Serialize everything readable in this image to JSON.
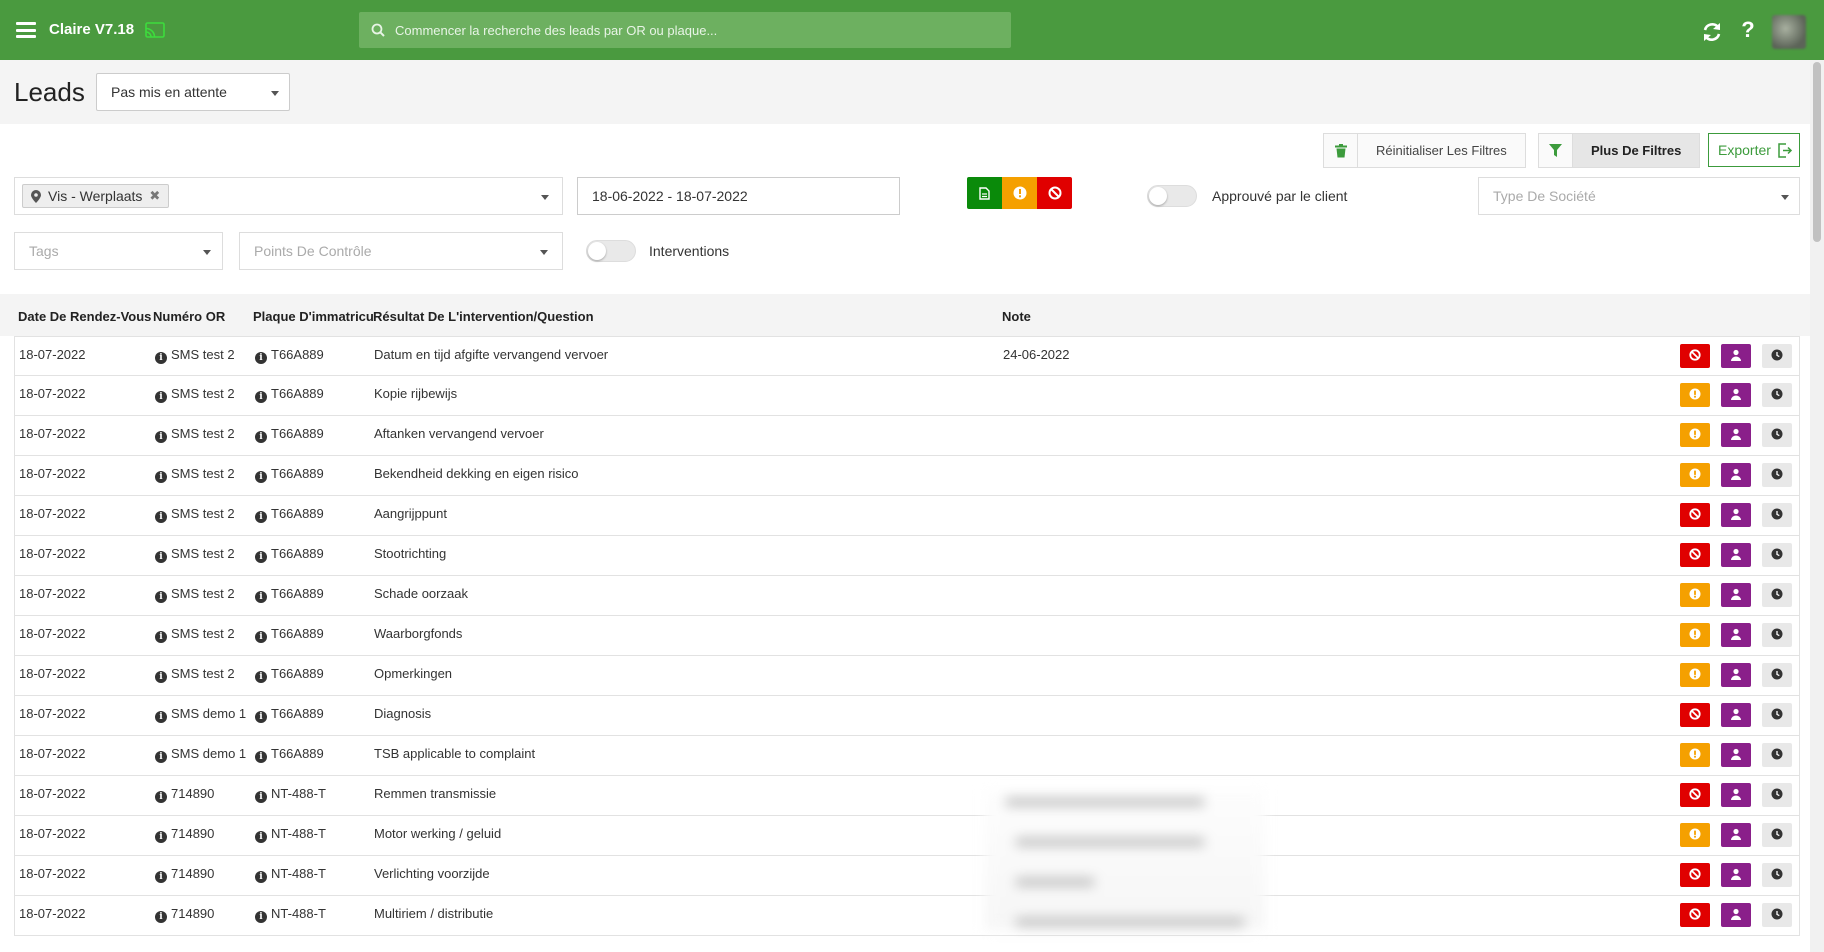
{
  "app": {
    "title": "Claire V7.18"
  },
  "search": {
    "placeholder": "Commencer la recherche des leads par OR ou plaque..."
  },
  "page": {
    "title": "Leads",
    "status_filter": "Pas mis en attente"
  },
  "toolbar": {
    "reset_label": "Réinitialiser Les Filtres",
    "more_filters_label": "Plus De Filtres",
    "export_label": "Exporter"
  },
  "filters": {
    "location_tag": "Vis - Werplaats",
    "date_range": "18-06-2022 - 18-07-2022",
    "approved_label": "Approuvé par le client",
    "company_type_placeholder": "Type De Société",
    "tags_placeholder": "Tags",
    "checkpoints_placeholder": "Points De Contrôle",
    "interventions_label": "Interventions"
  },
  "table": {
    "headers": [
      "Date De Rendez-Vous",
      "Numéro OR",
      "Plaque D'immatricu",
      "Résultat De L'intervention/Question",
      "Note"
    ],
    "rows": [
      {
        "date": "18-07-2022",
        "or": "SMS test 2",
        "plate": "T66A889",
        "result": "Datum en tijd afgifte vervangend vervoer",
        "note": "24-06-2022",
        "status": "red"
      },
      {
        "date": "18-07-2022",
        "or": "SMS test 2",
        "plate": "T66A889",
        "result": "Kopie rijbewijs",
        "note": "",
        "status": "orange"
      },
      {
        "date": "18-07-2022",
        "or": "SMS test 2",
        "plate": "T66A889",
        "result": "Aftanken vervangend vervoer",
        "note": "",
        "status": "orange"
      },
      {
        "date": "18-07-2022",
        "or": "SMS test 2",
        "plate": "T66A889",
        "result": "Bekendheid dekking en eigen risico",
        "note": "",
        "status": "orange"
      },
      {
        "date": "18-07-2022",
        "or": "SMS test 2",
        "plate": "T66A889",
        "result": "Aangrijppunt",
        "note": "",
        "status": "red"
      },
      {
        "date": "18-07-2022",
        "or": "SMS test 2",
        "plate": "T66A889",
        "result": "Stootrichting",
        "note": "",
        "status": "red"
      },
      {
        "date": "18-07-2022",
        "or": "SMS test 2",
        "plate": "T66A889",
        "result": "Schade oorzaak",
        "note": "",
        "status": "orange"
      },
      {
        "date": "18-07-2022",
        "or": "SMS test 2",
        "plate": "T66A889",
        "result": "Waarborgfonds",
        "note": "",
        "status": "orange"
      },
      {
        "date": "18-07-2022",
        "or": "SMS test 2",
        "plate": "T66A889",
        "result": "Opmerkingen",
        "note": "",
        "status": "orange"
      },
      {
        "date": "18-07-2022",
        "or": "SMS demo 1",
        "plate": "T66A889",
        "result": "Diagnosis",
        "note": "",
        "status": "red"
      },
      {
        "date": "18-07-2022",
        "or": "SMS demo 1",
        "plate": "T66A889",
        "result": "TSB applicable to complaint",
        "note": "",
        "status": "orange"
      },
      {
        "date": "18-07-2022",
        "or": "714890",
        "plate": "NT-488-T",
        "result": "Remmen transmissie",
        "note": "",
        "status": "red"
      },
      {
        "date": "18-07-2022",
        "or": "714890",
        "plate": "NT-488-T",
        "result": "Motor werking / geluid",
        "note": "",
        "status": "orange"
      },
      {
        "date": "18-07-2022",
        "or": "714890",
        "plate": "NT-488-T",
        "result": "Verlichting voorzijde",
        "note": "",
        "status": "red"
      },
      {
        "date": "18-07-2022",
        "or": "714890",
        "plate": "NT-488-T",
        "result": "Multiriem / distributie",
        "note": "",
        "status": "red"
      }
    ]
  },
  "colors": {
    "brand": "#4a9a3f",
    "danger": "#e00000",
    "warning": "#f5a000",
    "agent": "#8a1f8a",
    "ok": "#0a8a0a"
  },
  "icons": [
    "menu-icon",
    "cast-icon",
    "search-icon",
    "refresh-icon",
    "help-icon",
    "trash-icon",
    "filter-icon",
    "export-icon",
    "map-marker-icon",
    "close-icon",
    "file-icon",
    "warning-icon",
    "block-icon",
    "info-icon",
    "user-icon",
    "clock-icon"
  ]
}
